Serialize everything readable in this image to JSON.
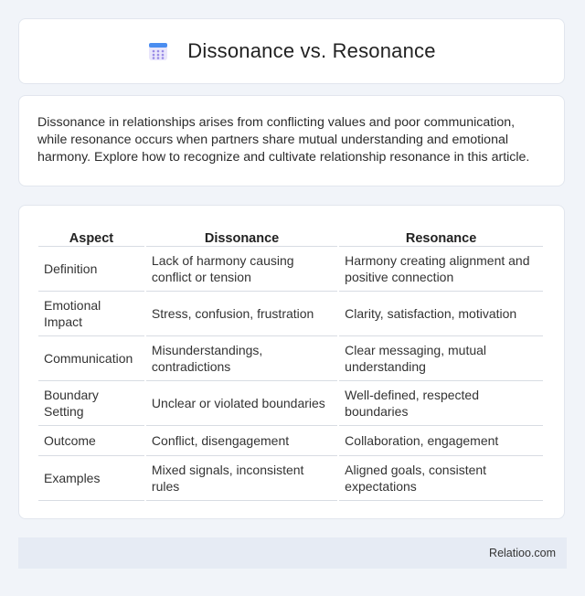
{
  "header": {
    "title": "Dissonance vs. Resonance",
    "icon": "calendar-icon"
  },
  "intro": {
    "text": "Dissonance in relationships arises from conflicting values and poor communication, while resonance occurs when partners share mutual understanding and emotional harmony. Explore how to recognize and cultivate relationship resonance in this article."
  },
  "table": {
    "headers": [
      "Aspect",
      "Dissonance",
      "Resonance"
    ],
    "rows": [
      [
        "Definition",
        "Lack of harmony causing conflict or tension",
        "Harmony creating alignment and positive connection"
      ],
      [
        "Emotional Impact",
        "Stress, confusion, frustration",
        "Clarity, satisfaction, motivation"
      ],
      [
        "Communication",
        "Misunderstandings, contradictions",
        "Clear messaging, mutual understanding"
      ],
      [
        "Boundary Setting",
        "Unclear or violated boundaries",
        "Well-defined, respected boundaries"
      ],
      [
        "Outcome",
        "Conflict, disengagement",
        "Collaboration, engagement"
      ],
      [
        "Examples",
        "Mixed signals, inconsistent rules",
        "Aligned goals, consistent expectations"
      ]
    ]
  },
  "footer": {
    "brand": "Relatioo.com"
  }
}
